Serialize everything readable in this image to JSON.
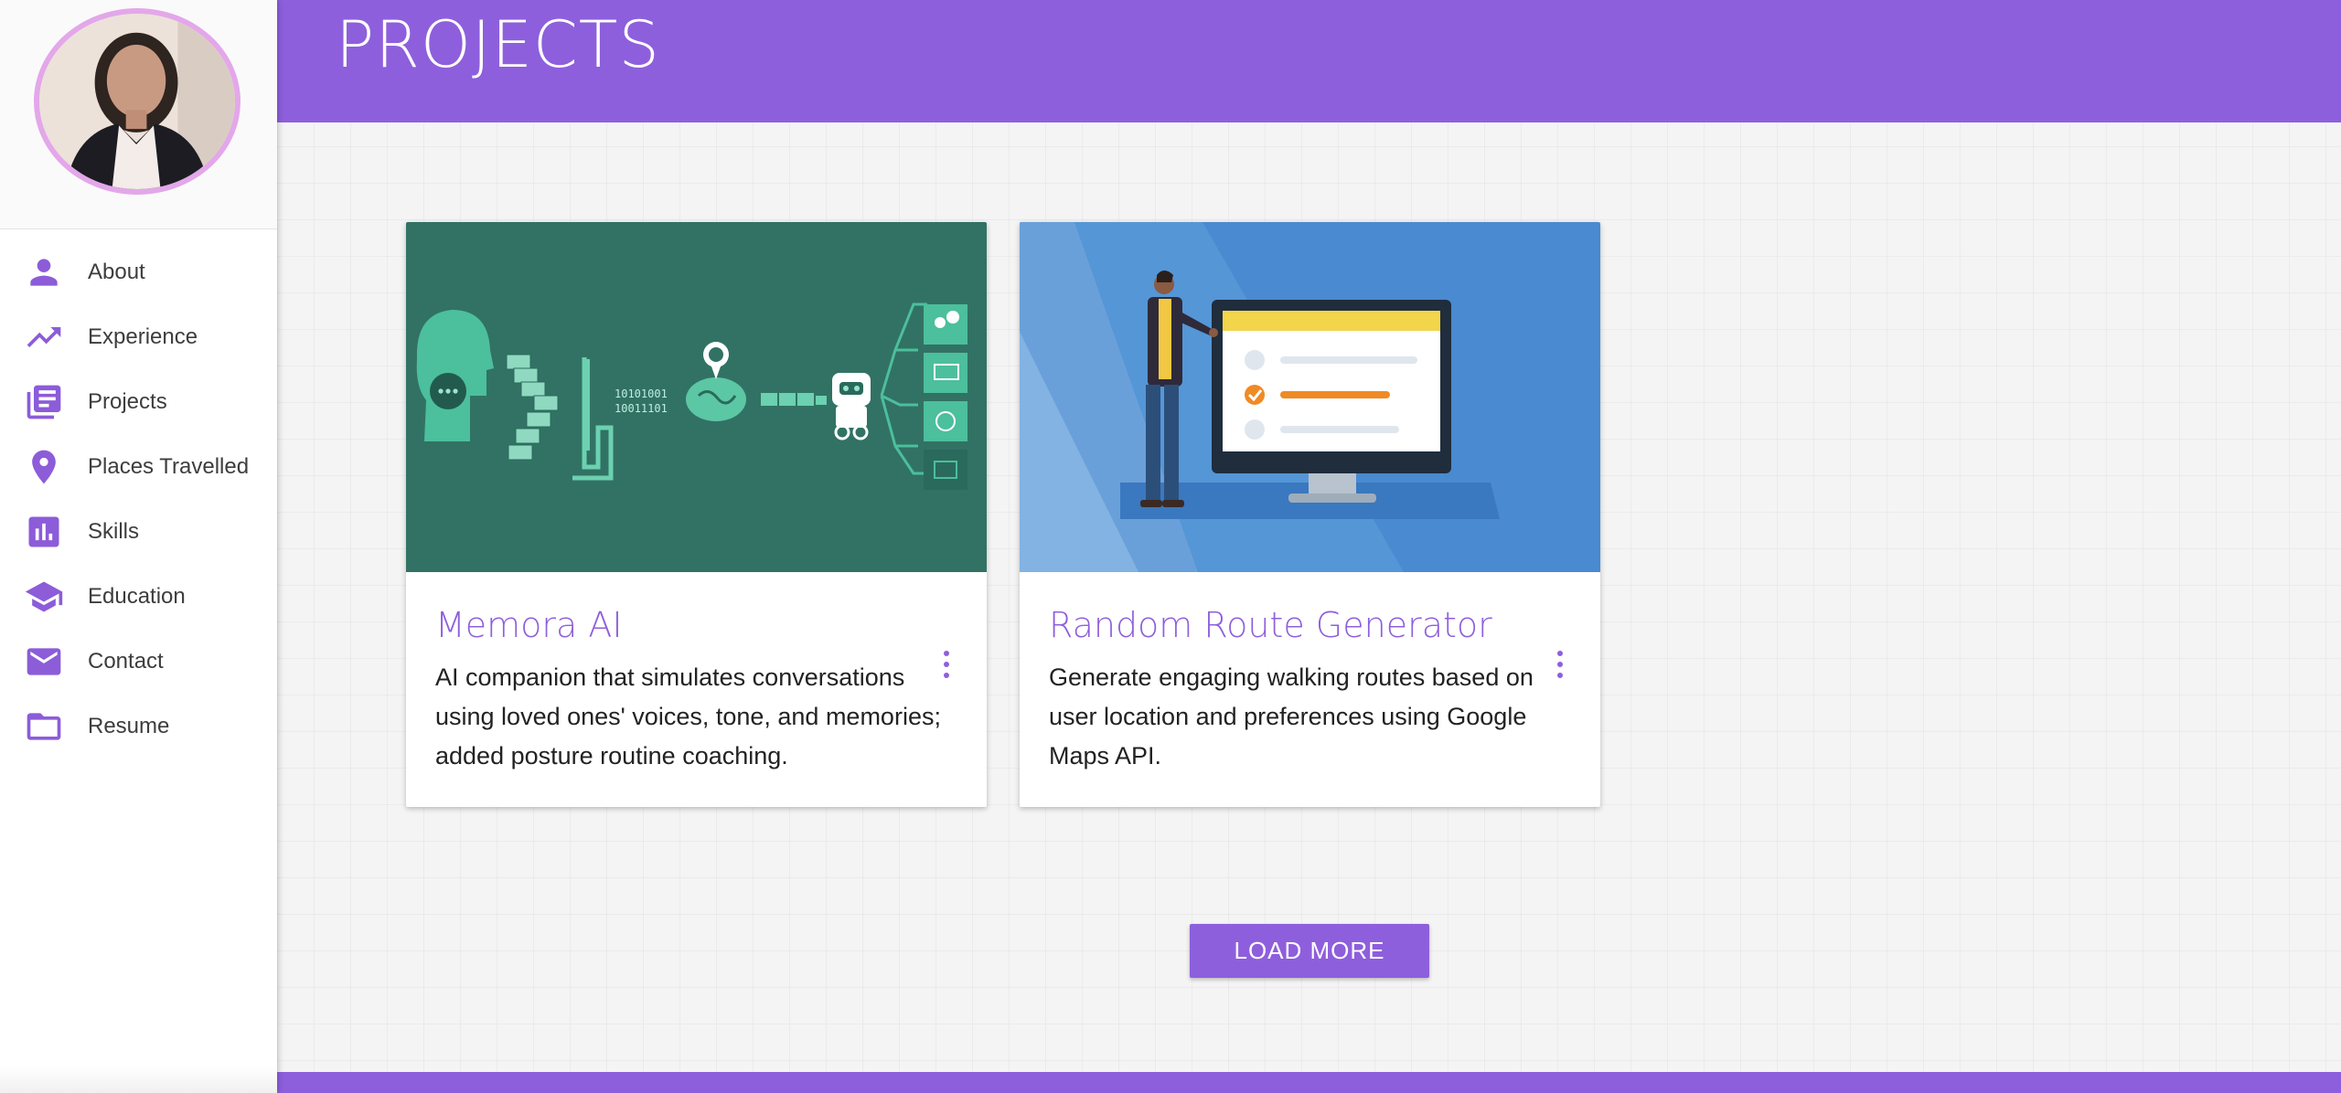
{
  "sidebar": {
    "items": [
      {
        "label": "About",
        "icon": "person-icon"
      },
      {
        "label": "Experience",
        "icon": "trending-up-icon"
      },
      {
        "label": "Projects",
        "icon": "library-books-icon"
      },
      {
        "label": "Places Travelled",
        "icon": "location-pin-icon"
      },
      {
        "label": "Skills",
        "icon": "bar-chart-icon"
      },
      {
        "label": "Education",
        "icon": "graduation-cap-icon"
      },
      {
        "label": "Contact",
        "icon": "mail-icon"
      },
      {
        "label": "Resume",
        "icon": "folder-icon"
      }
    ]
  },
  "header": {
    "title": "PROJECTS"
  },
  "projects": [
    {
      "title": "Memora AI",
      "description": "AI companion that simulates conversations using loved ones' voices, tone, and memories; added posture routine coaching.",
      "image_text": [
        "10101001",
        "10011101"
      ]
    },
    {
      "title": "Random Route Generator",
      "description": "Generate engaging walking routes based on user location and preferences using Google Maps API."
    }
  ],
  "load_more_label": "LOAD MORE",
  "colors": {
    "accent": "#8e5fdc",
    "avatar_border": "#e3a7ea",
    "card1_bg": "#317264",
    "card2_bg": "#4a8ad0"
  }
}
